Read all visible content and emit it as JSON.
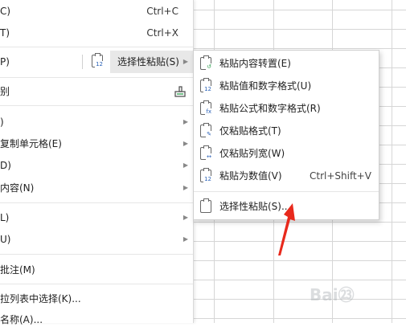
{
  "main_menu": {
    "items": [
      {
        "label": "C)",
        "shortcut": "Ctrl+C"
      },
      {
        "label": "T)",
        "shortcut": "Ctrl+X"
      },
      {
        "label": "P)",
        "active_label": "选择性粘贴(S)"
      },
      {
        "label": "别"
      },
      {
        "label": ")"
      },
      {
        "label": "复制单元格(E)"
      },
      {
        "label": "D)"
      },
      {
        "label": "内容(N)"
      },
      {
        "label": "L)"
      },
      {
        "label": "U)"
      },
      {
        "label": "批注(M)"
      },
      {
        "label": "拉列表中选择(K)..."
      },
      {
        "label": "名称(A)..."
      }
    ]
  },
  "submenu": {
    "items": [
      {
        "label": "粘贴内容转置(E)",
        "icon": "paste-transpose-icon"
      },
      {
        "label": "粘贴值和数字格式(U)",
        "icon": "paste-values-number-format-icon"
      },
      {
        "label": "粘贴公式和数字格式(R)",
        "icon": "paste-formula-number-format-icon"
      },
      {
        "label": "仅粘贴格式(T)",
        "icon": "paste-format-icon"
      },
      {
        "label": "仅粘贴列宽(W)",
        "icon": "paste-column-width-icon"
      },
      {
        "label": "粘贴为数值(V)",
        "icon": "paste-as-values-icon",
        "shortcut": "Ctrl+Shift+V"
      },
      {
        "label": "选择性粘贴(S)...",
        "icon": "paste-special-icon"
      }
    ]
  },
  "icon_badge": "12",
  "watermark": {
    "text": "Bai㉓"
  },
  "colors": {
    "arrow": "#e8291c",
    "highlight": "#e8e8e8",
    "grid": "#d6d6d6"
  }
}
